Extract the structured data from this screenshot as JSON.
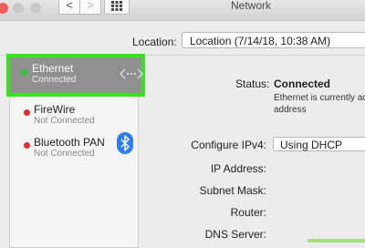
{
  "window": {
    "title": "Network"
  },
  "toolbar": {
    "back_glyph": "<",
    "forward_glyph": ">"
  },
  "location": {
    "label": "Location:",
    "value": "Location (7/14/18, 10:38 AM)"
  },
  "sidebar": {
    "items": [
      {
        "name": "Ethernet",
        "status": "Connected",
        "dot_color": "#2fc43a",
        "icon": "ethernet-arrows-icon",
        "selected": true
      },
      {
        "name": "FireWire",
        "status": "Not Connected",
        "dot_color": "#e02b2b",
        "icon": "",
        "selected": false
      },
      {
        "name": "Bluetooth PAN",
        "status": "Not Connected",
        "dot_color": "#e02b2b",
        "icon": "bluetooth-icon",
        "selected": false
      }
    ]
  },
  "detail": {
    "status_label": "Status:",
    "status_value": "Connected",
    "status_desc": "Ethernet  is currently ac address",
    "configure_label": "Configure IPv4:",
    "configure_value": "Using DHCP",
    "ip_label": "IP Address:",
    "subnet_label": "Subnet Mask:",
    "router_label": "Router:",
    "dns_label": "DNS Server:"
  },
  "colors": {
    "highlight_border": "#38e21e",
    "selected_bg": "#909090"
  }
}
